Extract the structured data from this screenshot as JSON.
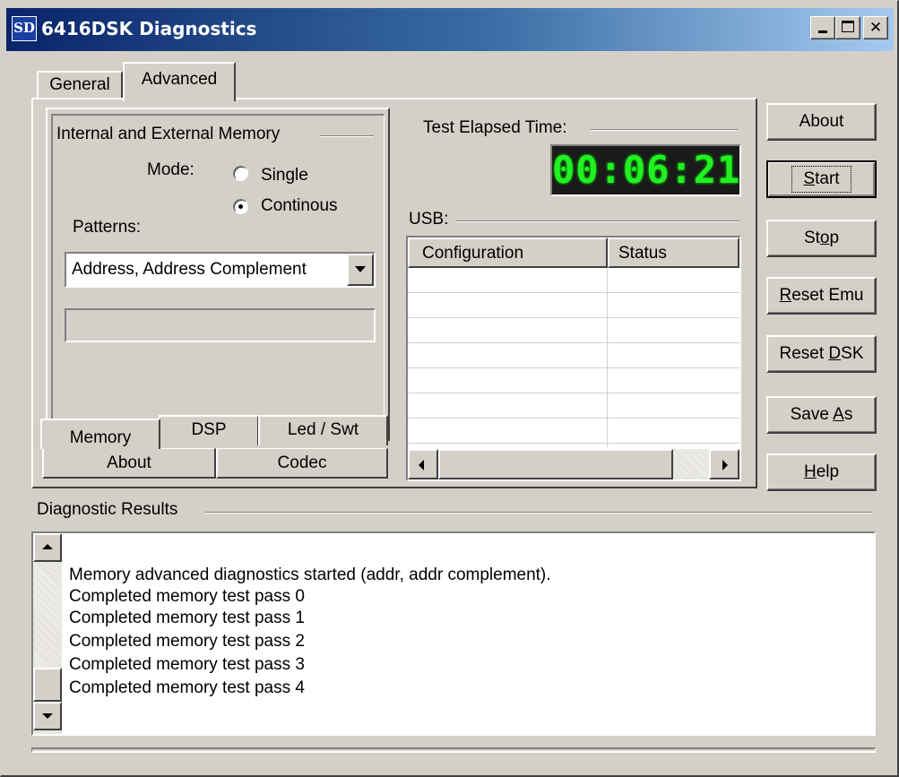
{
  "window": {
    "title": "6416DSK Diagnostics",
    "icon_text": "SD",
    "caption_buttons": [
      "minimize",
      "maximize",
      "close"
    ]
  },
  "tabs": [
    {
      "label": "General",
      "active": false
    },
    {
      "label": "Advanced",
      "active": true
    }
  ],
  "memory_group": {
    "title": "Internal and External Memory",
    "mode_label": "Mode:",
    "mode_options": [
      {
        "label": "Single",
        "selected": false
      },
      {
        "label": "Continous",
        "selected": true
      }
    ],
    "patterns_label": "Patterns:",
    "patterns_value": "Address, Address Complement"
  },
  "sub_tabs_row1": [
    "Memory",
    "DSP",
    "Led / Swt"
  ],
  "sub_tabs_row2": [
    "About",
    "Codec"
  ],
  "timer": {
    "label": "Test Elapsed Time:",
    "value": "00:06:21"
  },
  "usb": {
    "label": "USB:",
    "columns": [
      "Configuration",
      "Status"
    ]
  },
  "buttons": [
    {
      "label": "About",
      "underline": ""
    },
    {
      "label": "Start",
      "underline": "S"
    },
    {
      "label": "Stop",
      "underline": "o"
    },
    {
      "label": "Reset Emu",
      "underline": "R"
    },
    {
      "label": "Reset DSK",
      "underline": "D"
    },
    {
      "label": "Save As",
      "underline": "A"
    },
    {
      "label": "Help",
      "underline": "H"
    }
  ],
  "results": {
    "label": "Diagnostic Results",
    "lines": [
      "Memory advanced diagnostics started (addr, addr complement).",
      "Completed memory test pass 0",
      "Completed memory test pass 1",
      "Completed memory test pass 2",
      "Completed memory test pass 3",
      "Completed memory test pass 4"
    ]
  }
}
